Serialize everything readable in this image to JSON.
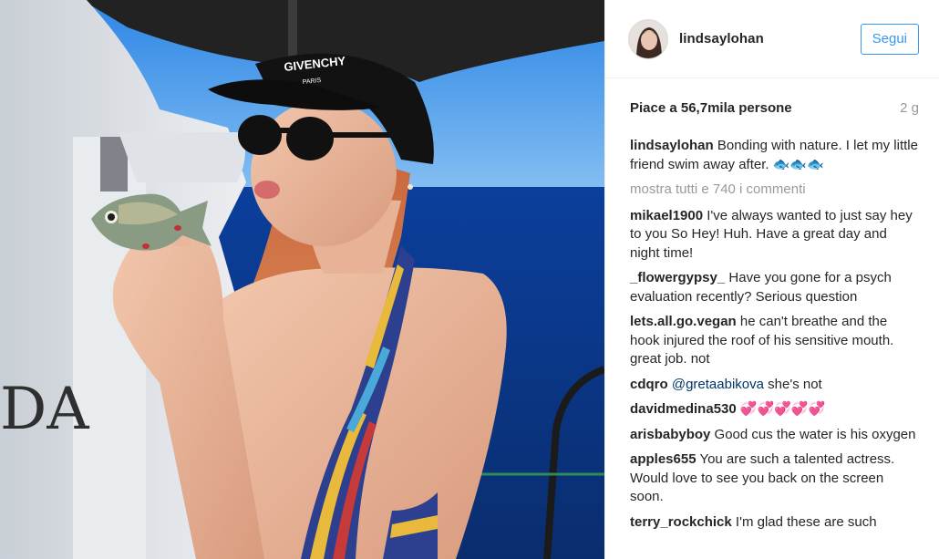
{
  "post": {
    "username": "lindsaylohan",
    "follow_label": "Segui",
    "likes": "Piace a 56,7mila persone",
    "time": "2 g",
    "caption_user": "lindsaylohan",
    "caption_text": "Bonding with nature. I let my little friend swim away after. 🐟🐟🐟",
    "view_all": "mostra tutti e 740 i commenti",
    "hat_text": "GIVENCHY",
    "hat_subtext": "PARIS",
    "boat_text": "DA"
  },
  "comments": [
    {
      "user": "mikael1900",
      "text": "I've always wanted to just say hey to you So Hey! Huh. Have a great day and night time!"
    },
    {
      "user": "_flowergypsy_",
      "text": "Have you gone for a psych evaluation recently? Serious question"
    },
    {
      "user": "lets.all.go.vegan",
      "text": "he can't breathe and the hook injured the roof of his sensitive mouth. great job. not"
    },
    {
      "user": "cdqro",
      "mention": "@gretaabikova",
      "text": "she's not"
    },
    {
      "user": "davidmedina530",
      "text": "💞💞💞💞💞"
    },
    {
      "user": "arisbabyboy",
      "text": "Good cus the water is his oxygen"
    },
    {
      "user": "apples655",
      "text": "You are such a talented actress. Would love to see you back on the screen soon."
    },
    {
      "user": "terry_rockchick",
      "text": "I'm glad these are such"
    }
  ],
  "colors": {
    "follow_blue": "#3897f0",
    "text": "#262626",
    "muted": "#999999",
    "mention": "#003569"
  }
}
